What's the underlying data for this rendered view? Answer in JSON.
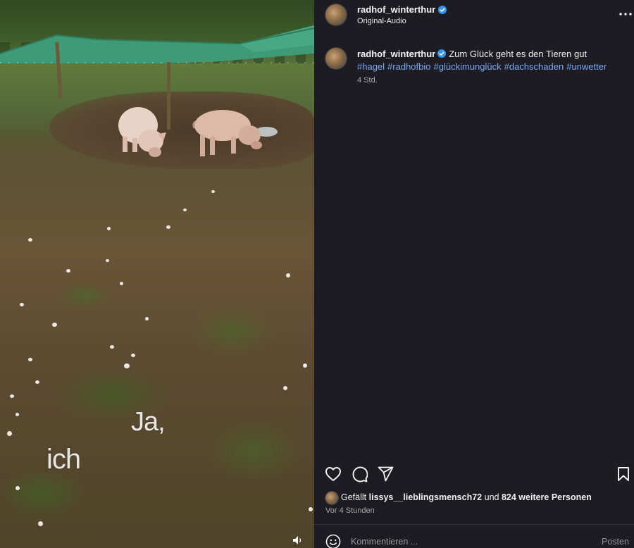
{
  "media": {
    "caption_line1": "Ja,",
    "caption_line2": "ich",
    "mute_icon": "speaker-icon"
  },
  "header": {
    "username": "radhof_winterthur",
    "audio": "Original-Audio",
    "verified_icon": "verified-badge-icon",
    "more_icon": "more-options-icon"
  },
  "post": {
    "username": "radhof_winterthur",
    "caption": "Zum Glück geht es den Tieren gut",
    "hashtags": [
      "#hagel",
      "#radhofbio",
      "#glückimunglück",
      "#dachschaden",
      "#unwetter"
    ],
    "time_short": "4 Std."
  },
  "actions": {
    "like_icon": "heart-icon",
    "comment_icon": "comment-bubble-icon",
    "share_icon": "paper-plane-icon",
    "save_icon": "bookmark-icon"
  },
  "likes": {
    "prefix": "Gefällt",
    "liker": "lissys__lieblingsmensch72",
    "middle": "und",
    "others": "824 weitere Personen"
  },
  "time_long": "Vor 4 Stunden",
  "comment_box": {
    "placeholder": "Kommentieren ...",
    "post_label": "Posten",
    "emoji_icon": "emoji-icon"
  },
  "colors": {
    "background": "#1c1c22",
    "link": "#7ba7f5",
    "verified": "#3797f0",
    "secondary_text": "#a8a8a8"
  }
}
